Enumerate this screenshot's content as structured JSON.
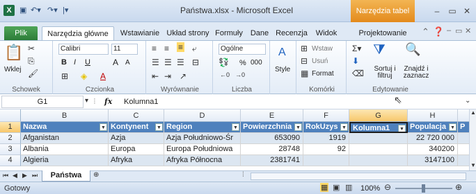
{
  "window": {
    "title": "Państwa.xlsx - Microsoft Excel",
    "context_tab_header": "Narzędzia tabel",
    "app_icon": "X"
  },
  "tabs": [
    "Plik",
    "Narzędzia główne",
    "Wstawianie",
    "Układ strony",
    "Formuły",
    "Dane",
    "Recenzja",
    "Widok",
    "Projektowanie"
  ],
  "ribbon": {
    "clipboard": {
      "paste": "Wklej",
      "label": "Schowek"
    },
    "font": {
      "name": "Calibri",
      "size": "11",
      "bold": "B",
      "italic": "I",
      "underline": "U",
      "grow": "A",
      "shrink": "A",
      "label": "Czcionka"
    },
    "alignment": {
      "label": "Wyrównanie"
    },
    "number": {
      "format": "Ogólne",
      "percent": "%",
      "thousands": "000",
      "label": "Liczba"
    },
    "styles": {
      "style": "Style"
    },
    "cells": {
      "insert": "Wstaw",
      "delete": "Usuń",
      "format": "Format",
      "label": "Komórki"
    },
    "editing": {
      "sort": "Sortuj i filtruj",
      "find": "Znajdź i zaznacz",
      "label": "Edytowanie"
    }
  },
  "formula_bar": {
    "name_box": "G1",
    "fx": "fx",
    "value": "Kolumna1"
  },
  "grid": {
    "columns": [
      "B",
      "C",
      "D",
      "E",
      "F",
      "G",
      "H"
    ],
    "next_col_label": "P",
    "rows": [
      {
        "n": "1",
        "cells": [
          "Nazwa",
          "Kontynent",
          "Region",
          "Powierzchnia",
          "RokUzys",
          "Kolumna1",
          "Populacja"
        ]
      },
      {
        "n": "2",
        "cells": [
          "Afganistan",
          "Azja",
          "Azja Południowo-Śr",
          "653090",
          "1919",
          "",
          "22 720 000"
        ]
      },
      {
        "n": "3",
        "cells": [
          "Albania",
          "Europa",
          "Europa Południowa",
          "28748",
          "92",
          "",
          "340200"
        ]
      },
      {
        "n": "4",
        "cells": [
          "Algieria",
          "Afryka",
          "Afryka Północna",
          "2381741",
          "",
          "",
          "3147100"
        ]
      }
    ]
  },
  "sheet_tab": "Państwa",
  "status": {
    "ready": "Gotowy",
    "zoom": "100%"
  }
}
